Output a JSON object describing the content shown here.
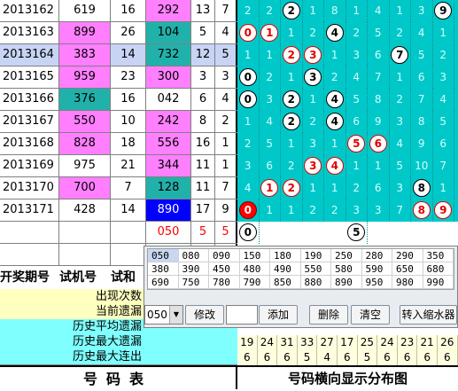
{
  "rows": [
    {
      "issue": "2013162",
      "trial": "619",
      "sum": "16",
      "pre": "292",
      "a": "13",
      "b": "7",
      "trial_bg": "",
      "pre_bg": "bg-magenta",
      "selected": false,
      "grid": [
        "2",
        "2",
        "2",
        "1",
        "8",
        "1",
        "4",
        "1",
        "3",
        "9"
      ],
      "hits": [
        2,
        9
      ],
      "red": []
    },
    {
      "issue": "2013163",
      "trial": "899",
      "sum": "26",
      "pre": "104",
      "a": "5",
      "b": "4",
      "trial_bg": "bg-pink",
      "pre_bg": "bg-teal",
      "selected": false,
      "grid": [
        "0",
        "1",
        "1",
        "2",
        "4",
        "2",
        "5",
        "2",
        "4",
        "1"
      ],
      "hits": [
        4
      ],
      "red": [
        0,
        1
      ]
    },
    {
      "issue": "2013164",
      "trial": "383",
      "sum": "14",
      "pre": "732",
      "a": "12",
      "b": "5",
      "trial_bg": "bg-pink",
      "pre_bg": "bg-teal",
      "selected": true,
      "grid": [
        "1",
        "1",
        "2",
        "3",
        "1",
        "3",
        "6",
        "7",
        "5",
        "2"
      ],
      "hits": [
        7
      ],
      "red": [
        2,
        3
      ]
    },
    {
      "issue": "2013165",
      "trial": "959",
      "sum": "23",
      "pre": "300",
      "a": "3",
      "b": "3",
      "trial_bg": "bg-pink",
      "pre_bg": "bg-magenta",
      "selected": false,
      "grid": [
        "0",
        "2",
        "1",
        "3",
        "2",
        "4",
        "7",
        "1",
        "6",
        "3"
      ],
      "hits": [
        0,
        3
      ],
      "red": []
    },
    {
      "issue": "2013166",
      "trial": "376",
      "sum": "16",
      "pre": "042",
      "a": "6",
      "b": "4",
      "trial_bg": "bg-teal",
      "pre_bg": "",
      "selected": false,
      "grid": [
        "0",
        "3",
        "2",
        "1",
        "4",
        "5",
        "8",
        "2",
        "7",
        "4"
      ],
      "hits": [
        0,
        2,
        4
      ],
      "red": []
    },
    {
      "issue": "2013167",
      "trial": "550",
      "sum": "10",
      "pre": "242",
      "a": "8",
      "b": "2",
      "trial_bg": "bg-pink",
      "pre_bg": "bg-magenta",
      "selected": false,
      "grid": [
        "1",
        "4",
        "2",
        "2",
        "4",
        "6",
        "9",
        "3",
        "8",
        "5"
      ],
      "hits": [
        2,
        4
      ],
      "red": []
    },
    {
      "issue": "2013168",
      "trial": "828",
      "sum": "18",
      "pre": "556",
      "a": "16",
      "b": "1",
      "trial_bg": "bg-pink",
      "pre_bg": "bg-magenta",
      "selected": false,
      "grid": [
        "2",
        "5",
        "1",
        "3",
        "1",
        "5",
        "6",
        "4",
        "9",
        "6"
      ],
      "hits": [],
      "red": [
        5,
        6
      ]
    },
    {
      "issue": "2013169",
      "trial": "975",
      "sum": "21",
      "pre": "344",
      "a": "11",
      "b": "1",
      "trial_bg": "",
      "pre_bg": "bg-magenta",
      "selected": false,
      "grid": [
        "3",
        "6",
        "2",
        "3",
        "4",
        "1",
        "1",
        "5",
        "10",
        "7"
      ],
      "hits": [],
      "red": [
        3,
        4
      ]
    },
    {
      "issue": "2013170",
      "trial": "700",
      "sum": "7",
      "pre": "128",
      "a": "11",
      "b": "7",
      "trial_bg": "bg-pink",
      "pre_bg": "bg-teal",
      "selected": false,
      "grid": [
        "4",
        "1",
        "2",
        "1",
        "1",
        "2",
        "6",
        "3",
        "8",
        "1"
      ],
      "hits": [
        8
      ],
      "red": [
        1,
        2
      ]
    },
    {
      "issue": "2013171",
      "trial": "428",
      "sum": "14",
      "pre": "890",
      "a": "17",
      "b": "9",
      "trial_bg": "",
      "pre_bg": "bg-blue",
      "selected": false,
      "grid": [
        "0",
        "1",
        "1",
        "2",
        "2",
        "3",
        "3",
        "7",
        "8",
        "9"
      ],
      "hits": [],
      "red": [
        8,
        9
      ],
      "redfill": [
        0
      ]
    }
  ],
  "pending": {
    "pre": "050",
    "a": "5",
    "b": "5",
    "balls": [
      "0",
      "5"
    ]
  },
  "headers": {
    "issue": "开奖期号",
    "trial": "试机号",
    "sum": "试和"
  },
  "stats_labels": [
    "出现次数",
    "当前遗漏",
    "历史平均遗漏",
    "历史最大遗漏",
    "历史最大连出"
  ],
  "right_stats": {
    "max_miss": [
      "19",
      "24",
      "31",
      "33",
      "27",
      "17",
      "25",
      "24",
      "23",
      "21",
      "26"
    ],
    "max_run": [
      "6",
      "6",
      "6",
      "5",
      "4",
      "6",
      "5",
      "6",
      "6",
      "6",
      "6"
    ]
  },
  "footer_left": "号码表",
  "footer_right": "号码横向显示分布图",
  "codes": [
    [
      "050",
      "080",
      "090",
      "150",
      "180",
      "190",
      "250",
      "280",
      "290",
      "350"
    ],
    [
      "380",
      "390",
      "450",
      "480",
      "490",
      "550",
      "580",
      "590",
      "650",
      "680"
    ],
    [
      "690",
      "750",
      "780",
      "790",
      "850",
      "880",
      "890",
      "950",
      "980",
      "990"
    ]
  ],
  "toolbar": {
    "select_value": "050",
    "modify": "修改",
    "add": "添加",
    "delete": "删除",
    "clear": "清空",
    "import": "转入缩水器"
  },
  "colors": {
    "grid_cyan": "#00c8c8",
    "pink": "#ff7fff",
    "teal": "#20b2aa",
    "blue": "#0000ff",
    "red": "#ff0000"
  }
}
